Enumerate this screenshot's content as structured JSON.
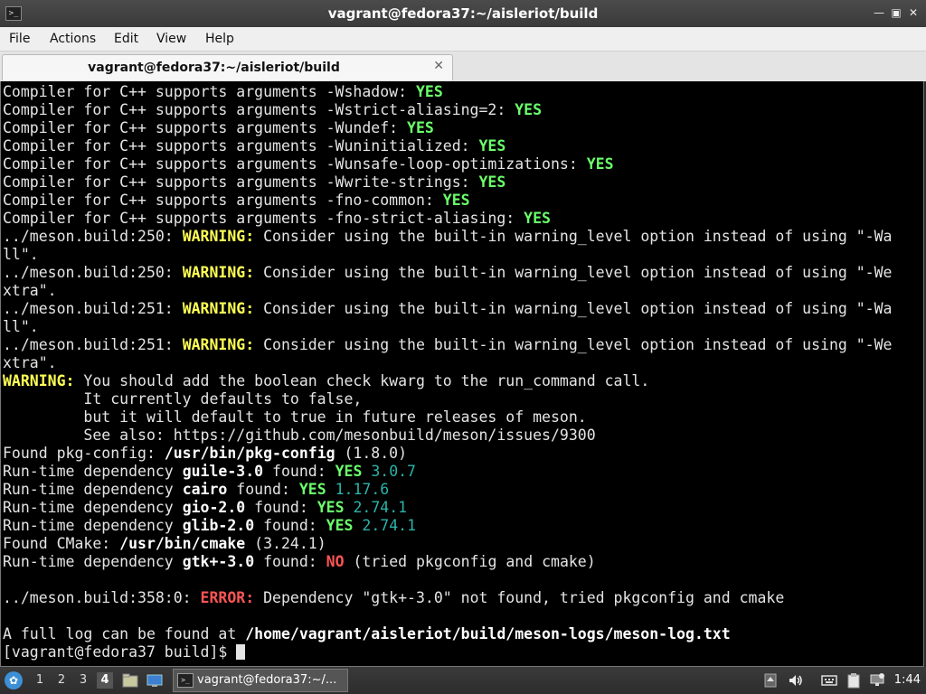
{
  "window": {
    "title": "vagrant@fedora37:~/aisleriot/build"
  },
  "menu": {
    "items": [
      "File",
      "Actions",
      "Edit",
      "View",
      "Help"
    ]
  },
  "tab": {
    "label": "vagrant@fedora37:~/aisleriot/build"
  },
  "terminal_lines": [
    [
      [
        "Compiler for C++ supports arguments -Wshadow: ",
        ""
      ],
      [
        "YES",
        "g"
      ]
    ],
    [
      [
        "Compiler for C++ supports arguments -Wstrict-aliasing=2: ",
        ""
      ],
      [
        "YES",
        "g"
      ]
    ],
    [
      [
        "Compiler for C++ supports arguments -Wundef: ",
        ""
      ],
      [
        "YES",
        "g"
      ]
    ],
    [
      [
        "Compiler for C++ supports arguments -Wuninitialized: ",
        ""
      ],
      [
        "YES",
        "g"
      ]
    ],
    [
      [
        "Compiler for C++ supports arguments -Wunsafe-loop-optimizations: ",
        ""
      ],
      [
        "YES",
        "g"
      ]
    ],
    [
      [
        "Compiler for C++ supports arguments -Wwrite-strings: ",
        ""
      ],
      [
        "YES",
        "g"
      ]
    ],
    [
      [
        "Compiler for C++ supports arguments -fno-common: ",
        ""
      ],
      [
        "YES",
        "g"
      ]
    ],
    [
      [
        "Compiler for C++ supports arguments -fno-strict-aliasing: ",
        ""
      ],
      [
        "YES",
        "g"
      ]
    ],
    [
      [
        "../meson.build:250: ",
        ""
      ],
      [
        "WARNING:",
        "y"
      ],
      [
        " Consider using the built-in warning_level option instead of using \"-Wa",
        ""
      ]
    ],
    [
      [
        "ll\".",
        ""
      ]
    ],
    [
      [
        "../meson.build:250: ",
        ""
      ],
      [
        "WARNING:",
        "y"
      ],
      [
        " Consider using the built-in warning_level option instead of using \"-We",
        ""
      ]
    ],
    [
      [
        "xtra\".",
        ""
      ]
    ],
    [
      [
        "../meson.build:251: ",
        ""
      ],
      [
        "WARNING:",
        "y"
      ],
      [
        " Consider using the built-in warning_level option instead of using \"-Wa",
        ""
      ]
    ],
    [
      [
        "ll\".",
        ""
      ]
    ],
    [
      [
        "../meson.build:251: ",
        ""
      ],
      [
        "WARNING:",
        "y"
      ],
      [
        " Consider using the built-in warning_level option instead of using \"-We",
        ""
      ]
    ],
    [
      [
        "xtra\".",
        ""
      ]
    ],
    [
      [
        "WARNING:",
        "y"
      ],
      [
        " You should add the boolean check kwarg to the run_command call.",
        ""
      ]
    ],
    [
      [
        "         It currently defaults to false,",
        ""
      ]
    ],
    [
      [
        "         but it will default to true in future releases of meson.",
        ""
      ]
    ],
    [
      [
        "         See also: https://github.com/mesonbuild/meson/issues/9300",
        ""
      ]
    ],
    [
      [
        "Found pkg-config: ",
        ""
      ],
      [
        "/usr/bin/pkg-config",
        "b"
      ],
      [
        " (1.8.0)",
        ""
      ]
    ],
    [
      [
        "Run-time dependency ",
        ""
      ],
      [
        "guile-3.0",
        "b"
      ],
      [
        " found: ",
        ""
      ],
      [
        "YES",
        "g"
      ],
      [
        " 3.0.7",
        "gn"
      ]
    ],
    [
      [
        "Run-time dependency ",
        ""
      ],
      [
        "cairo",
        "b"
      ],
      [
        " found: ",
        ""
      ],
      [
        "YES",
        "g"
      ],
      [
        " 1.17.6",
        "gn"
      ]
    ],
    [
      [
        "Run-time dependency ",
        ""
      ],
      [
        "gio-2.0",
        "b"
      ],
      [
        " found: ",
        ""
      ],
      [
        "YES",
        "g"
      ],
      [
        " 2.74.1",
        "gn"
      ]
    ],
    [
      [
        "Run-time dependency ",
        ""
      ],
      [
        "glib-2.0",
        "b"
      ],
      [
        " found: ",
        ""
      ],
      [
        "YES",
        "g"
      ],
      [
        " 2.74.1",
        "gn"
      ]
    ],
    [
      [
        "Found CMake: ",
        ""
      ],
      [
        "/usr/bin/cmake",
        "b"
      ],
      [
        " (3.24.1)",
        ""
      ]
    ],
    [
      [
        "Run-time dependency ",
        ""
      ],
      [
        "gtk+-3.0",
        "b"
      ],
      [
        " found: ",
        ""
      ],
      [
        "NO",
        "r"
      ],
      [
        " (tried pkgconfig and cmake)",
        ""
      ]
    ],
    [
      [
        "",
        ""
      ]
    ],
    [
      [
        "../meson.build:358:0: ",
        ""
      ],
      [
        "ERROR:",
        "r"
      ],
      [
        " Dependency \"gtk+-3.0\" not found, tried pkgconfig and cmake",
        ""
      ]
    ],
    [
      [
        "",
        ""
      ]
    ],
    [
      [
        "A full log can be found at ",
        ""
      ],
      [
        "/home/vagrant/aisleriot/build/meson-logs/meson-log.txt",
        "b"
      ]
    ]
  ],
  "prompt": "[vagrant@fedora37 build]$ ",
  "taskbar": {
    "workspaces": [
      "1",
      "2",
      "3",
      "4"
    ],
    "active_workspace": "4",
    "task_label": "vagrant@fedora37:~/...",
    "clock": "1:44"
  }
}
